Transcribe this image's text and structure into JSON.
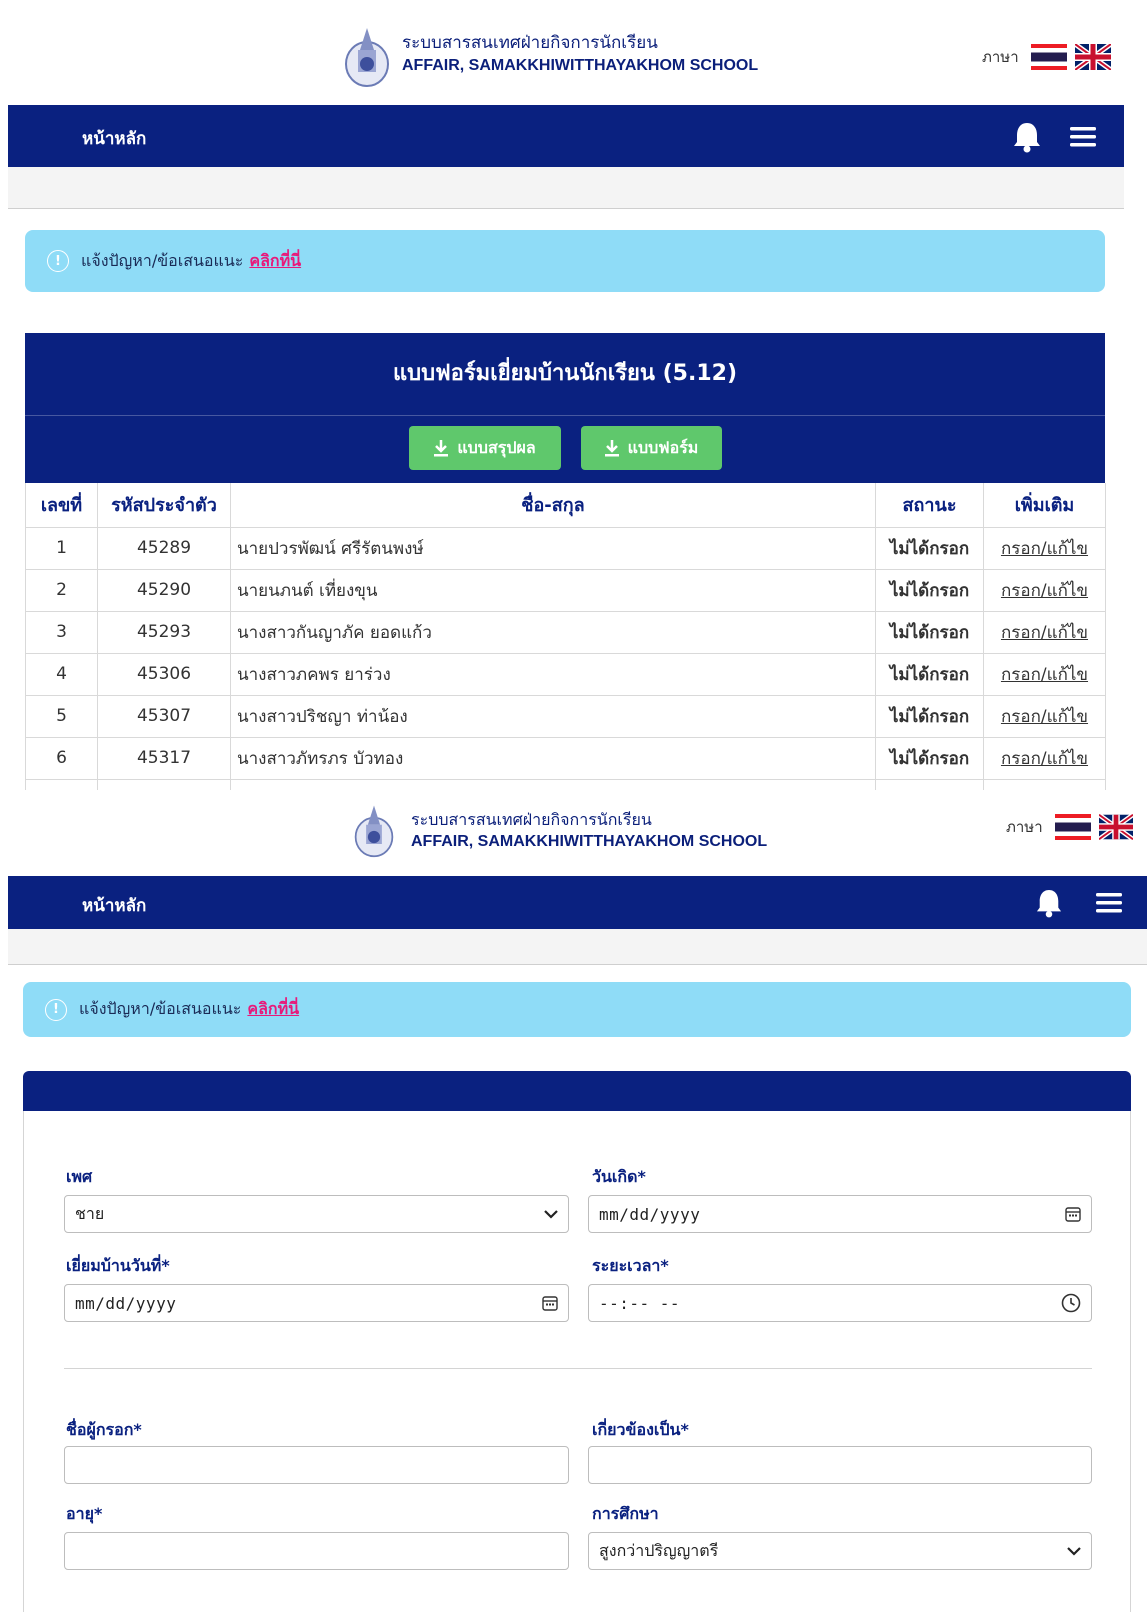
{
  "header": {
    "title_th": "ระบบสารสนเทศฝ่ายกิจการนักเรียน",
    "title_en": "AFFAIR, SAMAKKHIWITTHAYAKHOM SCHOOL",
    "language_label": "ภาษา",
    "flags": [
      "thai-flag",
      "uk-flag"
    ]
  },
  "nav": {
    "home_label": "หน้าหลัก",
    "icons": [
      "bell-icon",
      "menu-icon"
    ]
  },
  "alert": {
    "text": "แจ้งปัญหา/ข้อเสนอแนะ",
    "link": "คลิกที่นี่"
  },
  "visit_card": {
    "title": "แบบฟอร์มเยี่ยมบ้านนักเรียน (5.12)",
    "summary_button": "แบบสรุปผล",
    "form_button": "แบบฟอร์ม",
    "columns": [
      "เลขที่",
      "รหัสประจำตัว",
      "ชื่อ-สกุล",
      "สถานะ",
      "เพิ่มเติม"
    ],
    "rows": [
      {
        "no": "1",
        "id": "45289",
        "name": "นายปวรพัฒน์ ศรีรัตนพงษ์",
        "status": "ไม่ได้กรอก",
        "action": "กรอก/แก้ไข"
      },
      {
        "no": "2",
        "id": "45290",
        "name": "นายนภนต์ เที่ยงขุน",
        "status": "ไม่ได้กรอก",
        "action": "กรอก/แก้ไข"
      },
      {
        "no": "3",
        "id": "45293",
        "name": "นางสาวกันญาภัค ยอดแก้ว",
        "status": "ไม่ได้กรอก",
        "action": "กรอก/แก้ไข"
      },
      {
        "no": "4",
        "id": "45306",
        "name": "นางสาวภคพร ยาร่วง",
        "status": "ไม่ได้กรอก",
        "action": "กรอก/แก้ไข"
      },
      {
        "no": "5",
        "id": "45307",
        "name": "นางสาวปริชญา ท่าน้อง",
        "status": "ไม่ได้กรอก",
        "action": "กรอก/แก้ไข"
      },
      {
        "no": "6",
        "id": "45317",
        "name": "นางสาวภัทรภร บัวทอง",
        "status": "ไม่ได้กรอก",
        "action": "กรอก/แก้ไข"
      }
    ]
  },
  "form": {
    "gender_label": "เพศ",
    "gender_value": "ชาย",
    "birthdate_label": "วันเกิด*",
    "birthdate_placeholder": "mm/dd/yyyy",
    "visit_date_label": "เยี่ยมบ้านวันที่*",
    "visit_date_placeholder": "mm/dd/yyyy",
    "duration_label": "ระยะเวลา*",
    "duration_placeholder": "--:-- --",
    "filler_name_label": "ชื่อผู้กรอก*",
    "relation_label": "เกี่ยวข้องเป็น*",
    "age_label": "อายุ*",
    "education_label": "การศึกษา",
    "education_value": "สูงกว่าปริญญาตรี"
  },
  "colors": {
    "navy": "#0a2180",
    "green_button": "#5fc86c",
    "alert_bg": "#8fdcf7",
    "status_red": "#e8194b",
    "link_pink": "#e8197a",
    "link_cyan": "#7fd0ef"
  }
}
